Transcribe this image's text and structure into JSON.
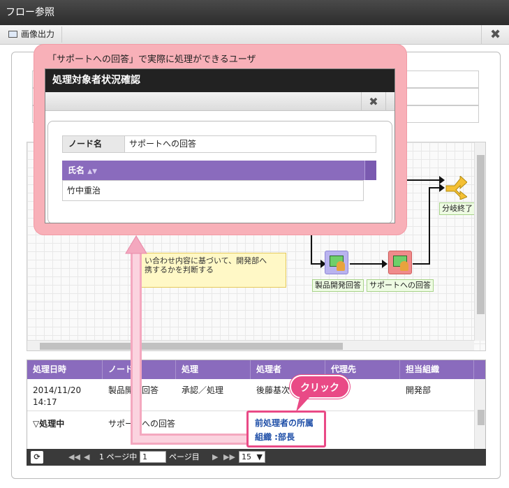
{
  "window": {
    "title": "フロー参照",
    "close_glyph": "✖"
  },
  "toolbar": {
    "image_output": "画像出力"
  },
  "flow": {
    "nodes": [
      {
        "label": "製品開発回答"
      },
      {
        "label": "サポートへの回答"
      },
      {
        "label": "分岐終了"
      }
    ],
    "memo": "い合わせ内容に基づいて、開発部へ\n携するかを判断する"
  },
  "history_grid": {
    "headers": [
      "処理日時",
      "ノード名",
      "処理",
      "処理者",
      "代理先",
      "担当組織"
    ],
    "rows": [
      {
        "date": "2014/11/20",
        "time": "14:17",
        "node": "製品開発回答",
        "action": "承認／処理",
        "user": "後藤基次",
        "proxy": "",
        "org": "開発部"
      },
      {
        "date": "▽処理中",
        "time": "",
        "node": "サポートへの回答",
        "action": "",
        "user": "前処理者の所属",
        "user2": "組織 :部長",
        "proxy": "",
        "org": ""
      }
    ],
    "pager": {
      "page_prefix": "1 ページ中",
      "page_value": "1",
      "page_suffix": "ページ目",
      "page_size": "15"
    }
  },
  "callout": {
    "text": "「サポートへの回答」で実際に処理ができるユーザ"
  },
  "dialog": {
    "title": "処理対象者状況確認",
    "node_label": "ノード名",
    "node_value": "サポートへの回答",
    "name_header": "氏名",
    "names": [
      "竹中重治"
    ]
  },
  "click_label": "クリック",
  "colors": {
    "grid_header": "#8a6bbd",
    "callout_bg": "#f8b0b8",
    "accent_pink": "#e94a86",
    "node_label_bg": "#eefbe3"
  }
}
